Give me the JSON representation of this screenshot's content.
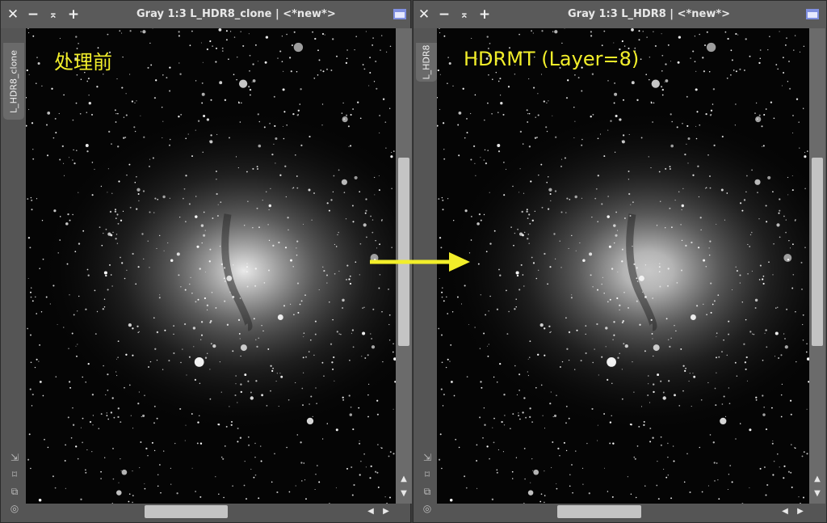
{
  "windows": [
    {
      "title": "Gray 1:3 L_HDR8_clone | <*new*>",
      "tab_label": "L_HDR8_clone",
      "overlay_label": "处理前"
    },
    {
      "title": "Gray 1:3 L_HDR8 | <*new*>",
      "tab_label": "L_HDR8",
      "overlay_label": "HDRMT (Layer=8)"
    }
  ],
  "titlebar_buttons": {
    "close": "✕",
    "minimize": "−",
    "maximize": "⌅",
    "add": "+"
  },
  "colors": {
    "overlay_text": "#f2ee2a",
    "arrow": "#f2ee2a",
    "shade_icon": "#7f8fe0",
    "canvas_background": "#050505"
  },
  "icons": [
    "close-icon",
    "minimize-icon",
    "maximize-icon",
    "add-icon",
    "shade-icon",
    "zoom-fit-icon",
    "crosshair-icon",
    "clone-icon",
    "target-icon",
    "scroll-up-icon",
    "scroll-down-icon",
    "scroll-left-icon",
    "scroll-right-icon"
  ]
}
